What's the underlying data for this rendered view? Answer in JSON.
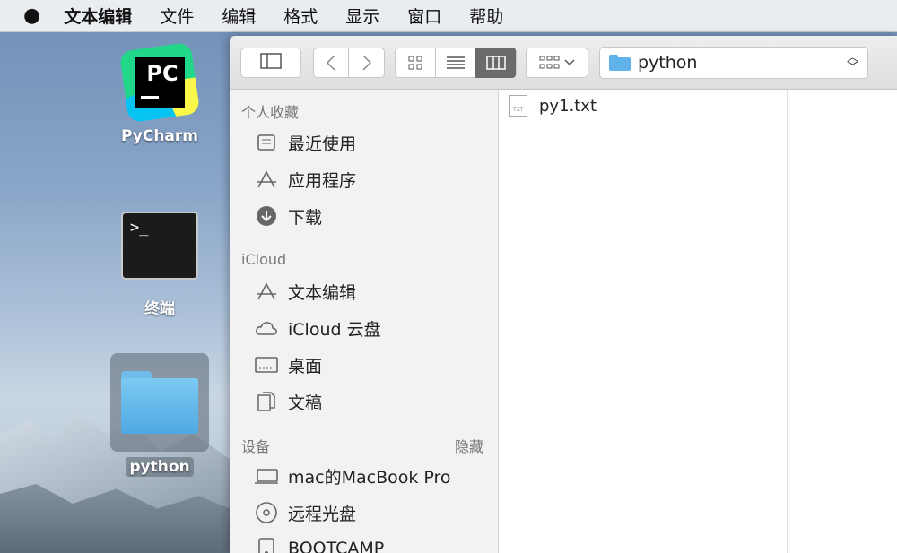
{
  "menubar": {
    "apple": "",
    "items": [
      "文本编辑",
      "文件",
      "编辑",
      "格式",
      "显示",
      "窗口",
      "帮助"
    ]
  },
  "desktop": {
    "pycharm": {
      "logo_text": "PC",
      "label": "PyCharm"
    },
    "terminal": {
      "prompt": ">_",
      "label": "终端"
    },
    "folder": {
      "label": "python"
    }
  },
  "toolbar": {
    "path": "python"
  },
  "sidebar": {
    "favorites_header": "个人收藏",
    "favorites": [
      "最近使用",
      "应用程序",
      "下载"
    ],
    "icloud_header": "iCloud",
    "icloud": [
      "文本编辑",
      "iCloud 云盘",
      "桌面",
      "文稿"
    ],
    "devices_header": "设备",
    "devices_hide": "隐藏",
    "devices": [
      "mac的MacBook Pro",
      "远程光盘",
      "BOOTCAMP"
    ]
  },
  "files": {
    "items": [
      {
        "name": "py1.txt",
        "ext": "TXT"
      }
    ]
  }
}
